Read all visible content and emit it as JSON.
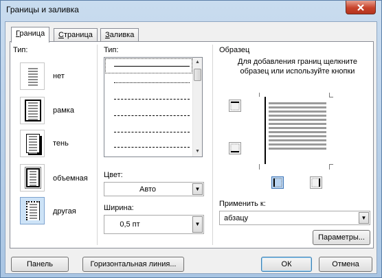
{
  "window": {
    "title": "Границы и заливка"
  },
  "tabs": [
    {
      "label_pre": "",
      "label_u": "Г",
      "label_post": "раница",
      "active": true
    },
    {
      "label_pre": "",
      "label_u": "С",
      "label_post": "траница",
      "active": false
    },
    {
      "label_pre": "",
      "label_u": "З",
      "label_post": "аливка",
      "active": false
    }
  ],
  "border_type": {
    "label": "Тип:",
    "items": [
      {
        "label": "нет",
        "icon": "no-border-icon"
      },
      {
        "label": "рамка",
        "icon": "box-border-icon"
      },
      {
        "label": "тень",
        "icon": "shadow-border-icon"
      },
      {
        "label": "объемная",
        "icon": "3d-border-icon"
      },
      {
        "label": "другая",
        "icon": "custom-border-icon",
        "selected": true
      }
    ]
  },
  "style": {
    "label": "Тип:",
    "lines": [
      "solid",
      "dotted",
      "dashed-small",
      "dashed",
      "dash-dot",
      "long-dash"
    ]
  },
  "color": {
    "label": "Цвет:",
    "value": "Авто"
  },
  "width": {
    "label": "Ширина:",
    "value": "0,5 пт"
  },
  "preview": {
    "label": "Образец",
    "hint": "Для добавления границ щелкните образец или используйте кнопки"
  },
  "apply_to": {
    "label": "Применить к:",
    "value": "абзацу"
  },
  "buttons": {
    "params": "Параметры...",
    "panel": "Панель",
    "hline": "Горизонтальная линия...",
    "ok": "ОК",
    "cancel": "Отмена"
  },
  "colors": {
    "accent": "#3c7fb1",
    "close": "#c7432b"
  }
}
